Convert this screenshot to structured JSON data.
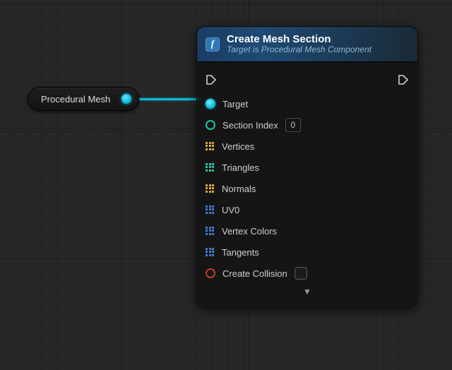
{
  "source_node": {
    "label": "Procedural Mesh"
  },
  "node": {
    "fn_glyph": "f",
    "title": "Create Mesh Section",
    "subtitle": "Target is Procedural Mesh Component",
    "pins": {
      "target": "Target",
      "section_index": {
        "label": "Section Index",
        "value": "0"
      },
      "vertices": "Vertices",
      "triangles": "Triangles",
      "normals": "Normals",
      "uv0": "UV0",
      "vertex_colors": "Vertex Colors",
      "tangents": "Tangents",
      "create_collision": "Create Collision"
    },
    "expand_glyph": "▼"
  }
}
